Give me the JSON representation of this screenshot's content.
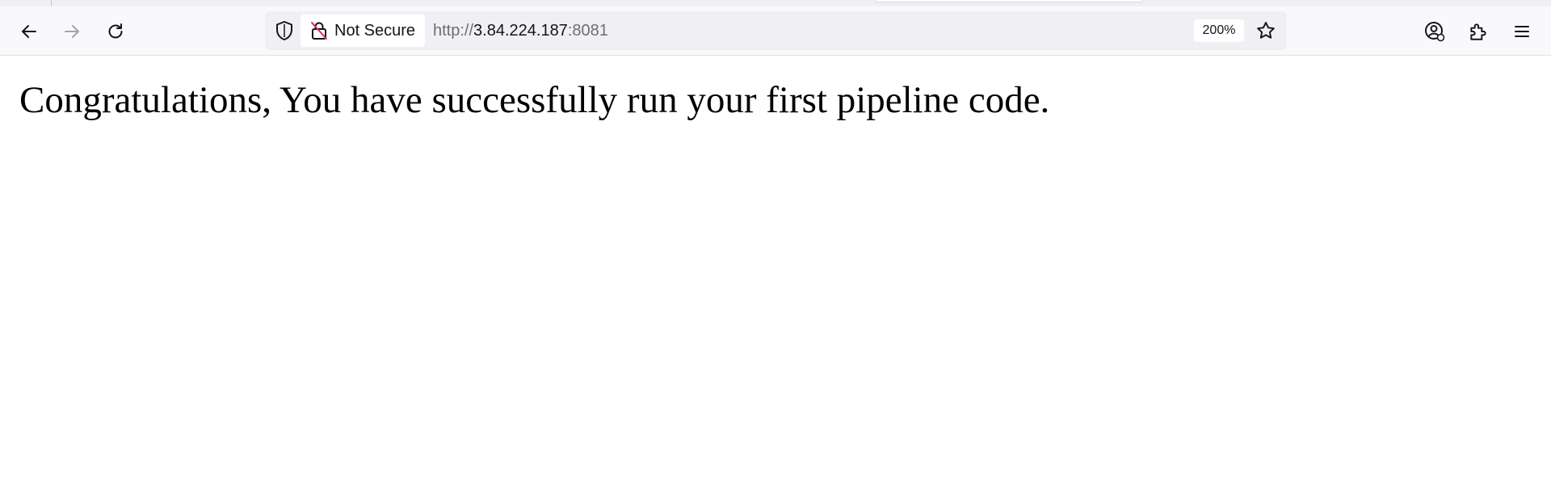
{
  "browser": {
    "toolbar": {
      "back_icon": "arrow-left-icon",
      "forward_icon": "arrow-right-icon",
      "reload_icon": "reload-icon",
      "account_icon": "account-icon",
      "extensions_icon": "extensions-icon",
      "menu_icon": "hamburger-menu-icon"
    },
    "urlbar": {
      "shield_icon": "shield-icon",
      "security_icon": "lock-slashed-icon",
      "security_label": "Not Secure",
      "url_scheme": "http://",
      "url_host": "3.84.224.187",
      "url_port": ":8081",
      "zoom_level": "200%",
      "bookmark_icon": "star-icon"
    }
  },
  "page": {
    "headline": "Congratulations, You have successfully run your first pipeline code."
  },
  "colors": {
    "toolbar_bg": "#f9f9fb",
    "urlbar_bg": "#f0f0f4",
    "insecure_accent": "#e22850",
    "text": "#15141a",
    "url_dim": "#6d6d74"
  }
}
